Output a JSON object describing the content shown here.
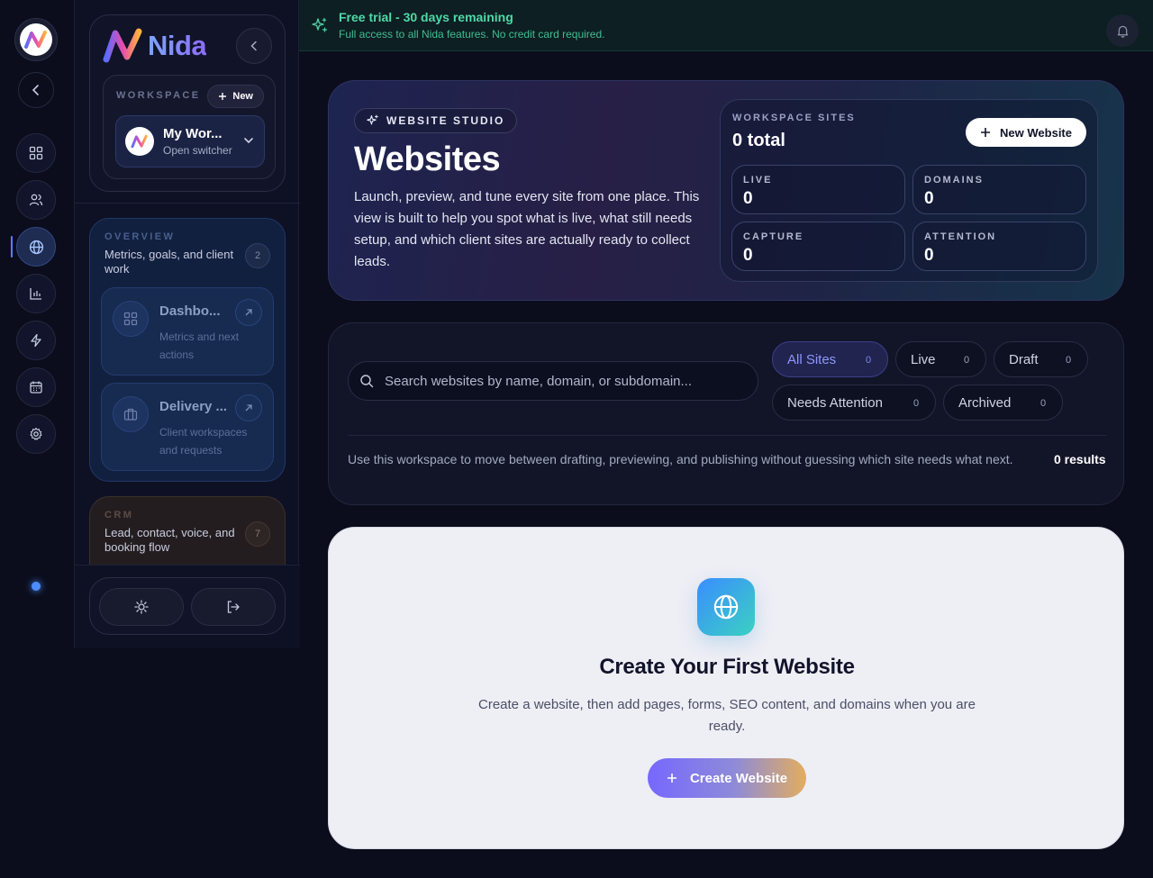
{
  "rail": {
    "items": [
      {
        "icon": "dashboard-grid-icon"
      },
      {
        "icon": "users-icon"
      },
      {
        "icon": "globe-icon",
        "active": true
      },
      {
        "icon": "bar-chart-icon"
      },
      {
        "icon": "lightning-icon"
      },
      {
        "icon": "calendar-icon"
      },
      {
        "icon": "gear-icon"
      }
    ]
  },
  "brand": {
    "name": "Nida"
  },
  "workspace": {
    "label": "WORKSPACE",
    "new_label": "New",
    "name": "My Wor...",
    "switcher_label": "Open switcher"
  },
  "groups": {
    "overview": {
      "kicker": "OVERVIEW",
      "title": "Metrics, goals, and client work",
      "count": "2",
      "items": [
        {
          "title": "Dashbo...",
          "desc": "Metrics and next actions"
        },
        {
          "title": "Delivery ...",
          "desc": "Client workspaces and requests"
        }
      ]
    },
    "crm": {
      "kicker": "CRM",
      "title": "Lead, contact, voice, and booking flow",
      "count": "7"
    }
  },
  "banner": {
    "title": "Free trial - 30 days remaining",
    "subtitle": "Full access to all Nida features. No credit card required."
  },
  "hero": {
    "pill": "WEBSITE STUDIO",
    "title": "Websites",
    "description": "Launch, preview, and tune every site from one place. This view is built to help you spot what is live, what still needs setup, and which client sites are actually ready to collect leads.",
    "stats_kicker": "WORKSPACE SITES",
    "stats_total": "0 total",
    "new_button": "New Website",
    "stats": [
      {
        "label": "LIVE",
        "value": "0"
      },
      {
        "label": "DOMAINS",
        "value": "0"
      },
      {
        "label": "CAPTURE",
        "value": "0"
      },
      {
        "label": "ATTENTION",
        "value": "0"
      }
    ]
  },
  "filters": {
    "search_placeholder": "Search websites by name, domain, or subdomain...",
    "chips": [
      {
        "label": "All Sites",
        "count": "0",
        "active": true
      },
      {
        "label": "Live",
        "count": "0"
      },
      {
        "label": "Draft",
        "count": "0"
      },
      {
        "label": "Needs Attention",
        "count": "0"
      },
      {
        "label": "Archived",
        "count": "0"
      }
    ],
    "note": "Use this workspace to move between drafting, previewing, and publishing without guessing which site needs what next.",
    "results": "0 results"
  },
  "empty": {
    "title": "Create Your First Website",
    "description": "Create a website, then add pages, forms, SEO content, and domains when you are ready.",
    "button": "Create Website"
  },
  "colors": {
    "accent": "#7668ff",
    "trial_green": "#4fd9a8",
    "active_chip": "#8e96ff"
  }
}
